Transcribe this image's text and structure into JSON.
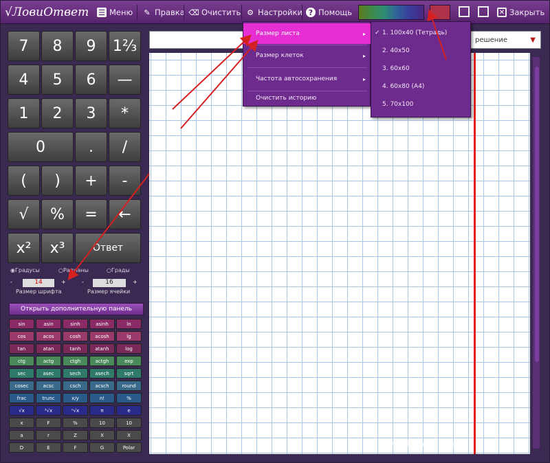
{
  "app": {
    "logo_text": "√ЛовиОтвет"
  },
  "toolbar": [
    {
      "label": "Меню",
      "icon": "menu-icon"
    },
    {
      "label": "Правка",
      "icon": "pencil-icon"
    },
    {
      "label": "Очистить",
      "icon": "broom-icon"
    },
    {
      "label": "Настройки",
      "icon": "gear-icon"
    },
    {
      "label": "Помощь",
      "icon": "help-icon"
    }
  ],
  "window": {
    "close_label": "Закрыть"
  },
  "keypad": {
    "keys": [
      "7",
      "8",
      "9",
      "1⅔",
      "—",
      "4",
      "5",
      "6",
      "*",
      "1",
      "2",
      "3",
      "/",
      "0",
      ".",
      "(",
      ")",
      "+",
      "-",
      "√",
      "%",
      "=",
      "←",
      "x²",
      "x³",
      "Ответ"
    ]
  },
  "modes": [
    "Градусы",
    "Радианы",
    "Грады"
  ],
  "steppers": {
    "left_label": "Размер шрифта",
    "left_value": "14",
    "right_label": "Размер ячейки",
    "right_value": "16"
  },
  "open_button": "Открыть дополнительную панель",
  "fn_keys": [
    [
      "sin",
      "asin",
      "sinh",
      "asinh",
      "ln"
    ],
    [
      "cos",
      "acos",
      "cosh",
      "acosh",
      "lg"
    ],
    [
      "tan",
      "atan",
      "tanh",
      "atanh",
      "log"
    ],
    [
      "ctg",
      "actg",
      "ctgh",
      "actgh",
      "exp"
    ],
    [
      "sec",
      "asec",
      "sech",
      "asech",
      "sqrt"
    ],
    [
      "cosec",
      "acsc",
      "csch",
      "acsch",
      "round"
    ],
    [
      "frac",
      "trunc",
      "x/y",
      "n!",
      "%"
    ],
    [
      "√x",
      "³√x",
      "ⁿ√x",
      "π",
      "e"
    ],
    [
      "x",
      "F",
      "%",
      "10",
      "10"
    ],
    [
      "a",
      "r",
      "Z",
      "X",
      "X"
    ],
    [
      "D",
      "E",
      "F",
      "G",
      "Polar"
    ]
  ],
  "menu_settings": [
    {
      "label": "Размер листа",
      "active": true,
      "submenu": true
    },
    {
      "label": "Размер клеток",
      "active": false,
      "submenu": true
    },
    {
      "label": "Частота автосохранения",
      "active": false,
      "submenu": true
    },
    {
      "label": "Очистить историю",
      "active": false,
      "submenu": false
    }
  ],
  "submenu_sheet": [
    {
      "label": "1. 100x40 (Тетрадь)",
      "checked": true
    },
    {
      "label": "2. 40x50",
      "checked": false
    },
    {
      "label": "3. 60x60",
      "checked": false
    },
    {
      "label": "4. 60x80 (А4)",
      "checked": false
    },
    {
      "label": "5. 70x100",
      "checked": false
    }
  ],
  "dropdown": {
    "value": "решение"
  },
  "watermark": "www.ibexwall.org",
  "colors": {
    "accent": "#6d2b8d",
    "highlight": "#e52fd3",
    "margin": "#e41f1f",
    "grid": "#a7c6ea"
  }
}
